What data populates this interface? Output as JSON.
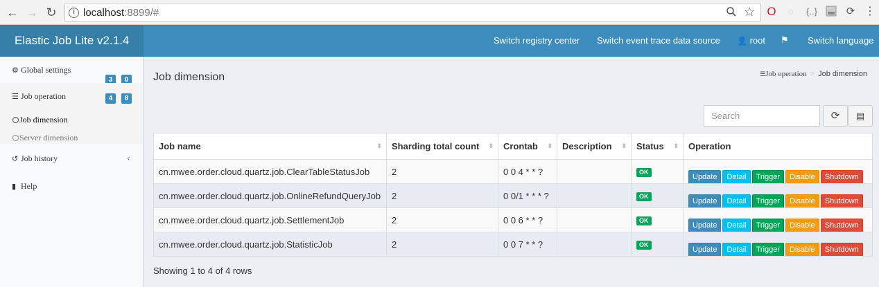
{
  "browser": {
    "url_host": "localhost",
    "url_rest": ":8899/#",
    "nav": {
      "back": "←",
      "forward": "→",
      "reload": "↻"
    },
    "extensions": [
      "opera-icon",
      "ghost-icon",
      "json-icon",
      "pdf-icon",
      "sync-icon",
      "menu-icon"
    ]
  },
  "header": {
    "brand": "Elastic Job Lite v2.1.4",
    "nav": {
      "registry": "Switch registry center",
      "event_trace": "Switch event trace data source",
      "user": "root",
      "language": "Switch language"
    }
  },
  "sidebar": {
    "global_settings": {
      "label": "Global settings",
      "badges": [
        "3",
        "0"
      ]
    },
    "job_operation": {
      "label": "Job operation",
      "badges": [
        "4",
        "8"
      ]
    },
    "job_dimension": "Job dimension",
    "server_dimension": "Server dimension",
    "job_history": "Job history",
    "help": "Help"
  },
  "content": {
    "title": "Job dimension",
    "breadcrumb": {
      "parent": "Job operation",
      "current": "Job dimension"
    },
    "search_placeholder": "Search",
    "summary": "Showing 1 to 4 of 4 rows"
  },
  "table": {
    "columns": [
      "Job name",
      "Sharding total count",
      "Crontab",
      "Description",
      "Status",
      "Operation"
    ],
    "rows": [
      {
        "name": "cn.mwee.order.cloud.quartz.job.ClearTableStatusJob",
        "sharding": "2",
        "cron": "0 0 4 * * ?",
        "description": "",
        "status": "OK"
      },
      {
        "name": "cn.mwee.order.cloud.quartz.job.OnlineRefundQueryJob",
        "sharding": "2",
        "cron": "0 0/1 * * * ?",
        "description": "",
        "status": "OK"
      },
      {
        "name": "cn.mwee.order.cloud.quartz.job.SettlementJob",
        "sharding": "2",
        "cron": "0 0 6 * * ?",
        "description": "",
        "status": "OK"
      },
      {
        "name": "cn.mwee.order.cloud.quartz.job.StatisticJob",
        "sharding": "2",
        "cron": "0 0 7 * * ?",
        "description": "",
        "status": "OK"
      }
    ],
    "actions": {
      "update": "Update",
      "detail": "Detail",
      "trigger": "Trigger",
      "disable": "Disable",
      "shutdown": "Shutdown"
    }
  },
  "colors": {
    "header": "#3c8dbc",
    "brand": "#367fa9",
    "update": "#3c8dbc",
    "detail": "#00c0ef",
    "trigger": "#00a65a",
    "disable": "#f39c12",
    "shutdown": "#dd4b39"
  }
}
